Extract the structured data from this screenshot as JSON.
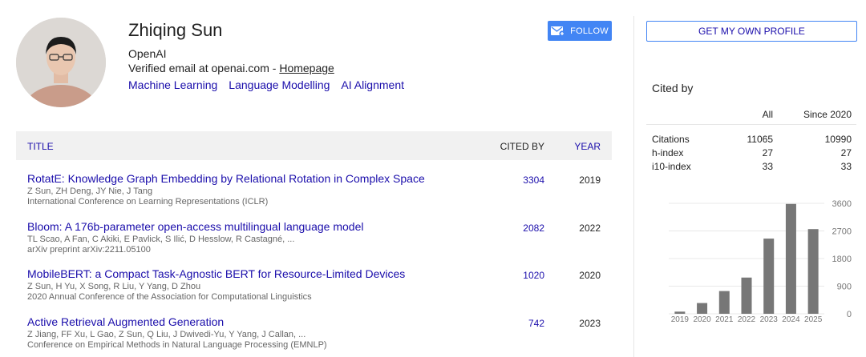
{
  "profile": {
    "name": "Zhiqing Sun",
    "affiliation": "OpenAI",
    "email_text": "Verified email at openai.com - ",
    "homepage_label": "Homepage",
    "interests": [
      "Machine Learning",
      "Language Modelling",
      "AI Alignment"
    ],
    "follow_label": "FOLLOW",
    "follow_icon": "mail-plus-icon"
  },
  "table": {
    "col_title": "TITLE",
    "col_cited": "CITED BY",
    "col_year": "YEAR",
    "articles": [
      {
        "title": "RotatE: Knowledge Graph Embedding by Relational Rotation in Complex Space",
        "authors": "Z Sun, ZH Deng, JY Nie, J Tang",
        "venue": "International Conference on Learning Representations (ICLR)",
        "cited": "3304",
        "year": "2019"
      },
      {
        "title": "Bloom: A 176b-parameter open-access multilingual language model",
        "authors": "TL Scao, A Fan, C Akiki, E Pavlick, S Ilić, D Hesslow, R Castagné, ...",
        "venue": "arXiv preprint arXiv:2211.05100",
        "cited": "2082",
        "year": "2022"
      },
      {
        "title": "MobileBERT: a Compact Task-Agnostic BERT for Resource-Limited Devices",
        "authors": "Z Sun, H Yu, X Song, R Liu, Y Yang, D Zhou",
        "venue": "2020 Annual Conference of the Association for Computational Linguistics",
        "cited": "1020",
        "year": "2020"
      },
      {
        "title": "Active Retrieval Augmented Generation",
        "authors": "Z Jiang, FF Xu, L Gao, Z Sun, Q Liu, J Dwivedi-Yu, Y Yang, J Callan, ...",
        "venue": "Conference on Empirical Methods in Natural Language Processing (EMNLP)",
        "cited": "742",
        "year": "2023"
      }
    ]
  },
  "sidebar": {
    "own_profile_label": "GET MY OWN PROFILE",
    "cited_by_title": "Cited by",
    "col_all": "All",
    "col_since": "Since 2020",
    "metrics": [
      {
        "label": "Citations",
        "all": "11065",
        "since": "10990"
      },
      {
        "label": "h-index",
        "all": "27",
        "since": "27"
      },
      {
        "label": "i10-index",
        "all": "33",
        "since": "33"
      }
    ]
  },
  "chart_data": {
    "type": "bar",
    "categories": [
      "2019",
      "2020",
      "2021",
      "2022",
      "2023",
      "2024",
      "2025"
    ],
    "values": [
      70,
      350,
      740,
      1180,
      2450,
      3580,
      2760
    ],
    "yticks": [
      "0",
      "900",
      "1800",
      "2700",
      "3600"
    ],
    "ylim": [
      0,
      3600
    ],
    "bar_color": "#777777",
    "grid": true
  }
}
